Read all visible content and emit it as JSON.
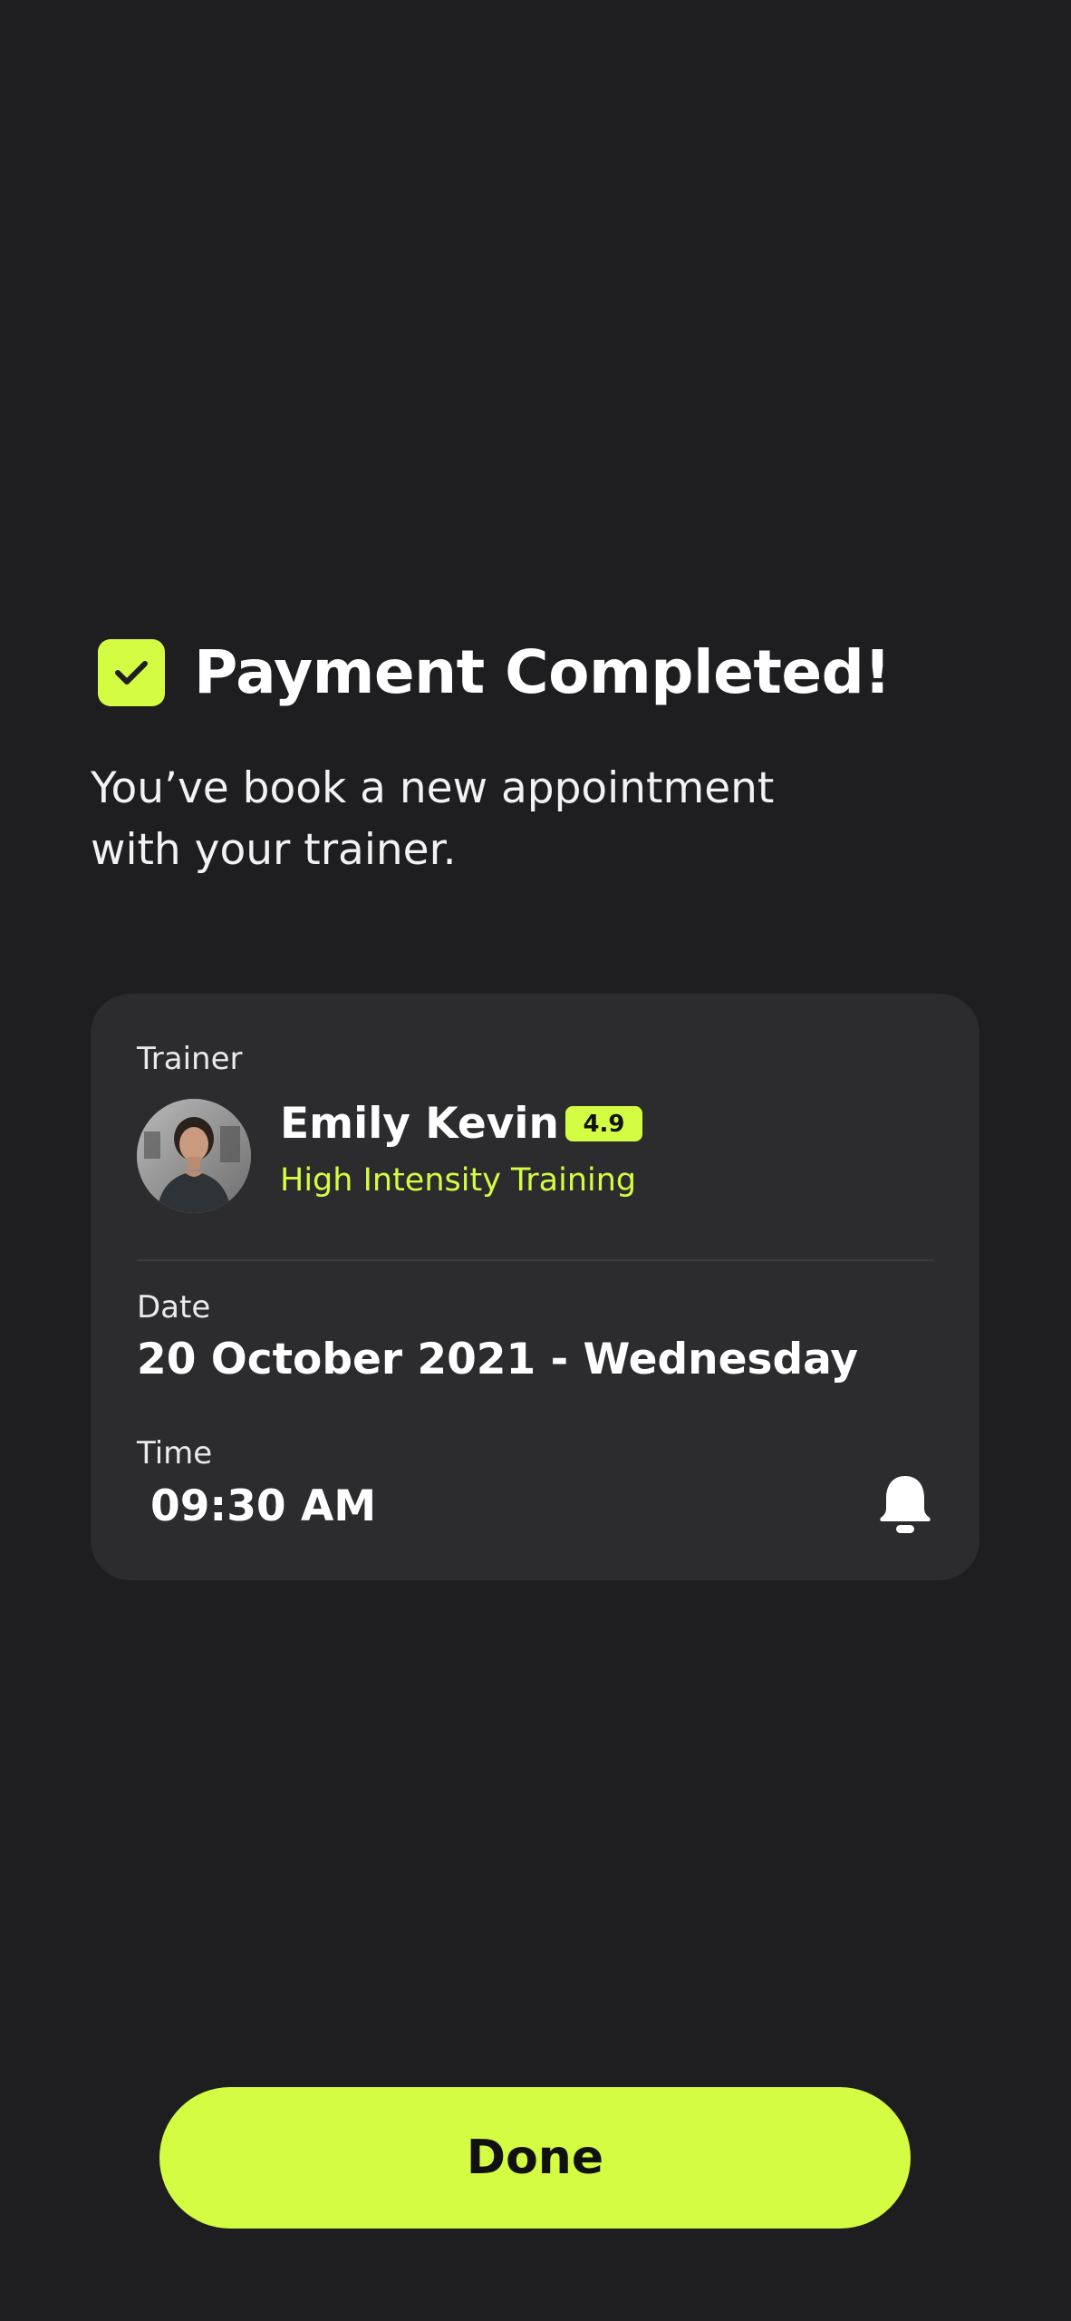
{
  "header": {
    "title": "Payment Completed!",
    "icon": "checkmark-icon",
    "subtitle_line1": "You’ve book a new appointment",
    "subtitle_line2": "with your trainer."
  },
  "card": {
    "trainer_label": "Trainer",
    "trainer_name": "Emily Kevin",
    "rating": "4.9",
    "trainer_specialty": "High Intensity Training",
    "date_label": "Date",
    "date_value": "20 October 2021 - Wednesday",
    "time_label": "Time",
    "time_value": "09:30 AM",
    "reminder_icon": "bell-icon"
  },
  "actions": {
    "done_label": "Done"
  },
  "colors": {
    "background": "#1e1e20",
    "card": "#2c2c2e",
    "accent": "#d4fc42",
    "text": "#ffffff"
  }
}
